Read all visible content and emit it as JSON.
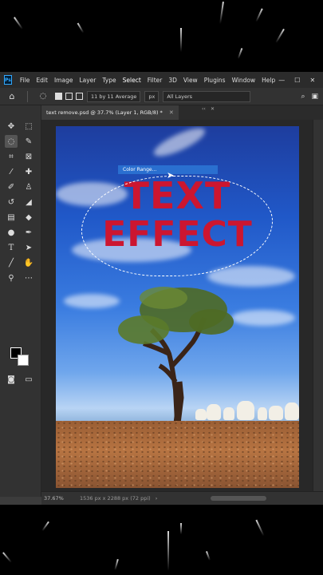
{
  "app": {
    "logo": "Ps"
  },
  "menu": {
    "items": [
      "File",
      "Edit",
      "Image",
      "Layer",
      "Type",
      "Select",
      "Filter",
      "3D",
      "View",
      "Plugins",
      "Window",
      "Help"
    ],
    "active": "Select",
    "window_controls": [
      "—",
      "☐",
      "✕"
    ]
  },
  "options_bar": {
    "sample_size": "11 by 11 Average",
    "tolerance_unit": "px",
    "sample_layers": "All Layers"
  },
  "document": {
    "tab_title": "text remove.psd @ 37.7% (Layer 1, RGB/8) *",
    "close_glyph": "✕"
  },
  "canvas": {
    "text_line1": "TEXT",
    "text_line2": "EFFECT",
    "text_color": "#cc1630"
  },
  "tooltip": {
    "label": "Color Range..."
  },
  "status": {
    "zoom": "37.67%",
    "doc_info": "1536 px x 2288 px (72 ppi)",
    "arrow": "›"
  },
  "colors": {
    "foreground": "#000000",
    "background": "#ffffff",
    "accent": "#31a8ff"
  },
  "icons": {
    "home": "home-icon",
    "lasso": "lasso-icon",
    "layers": "layers-icon"
  }
}
